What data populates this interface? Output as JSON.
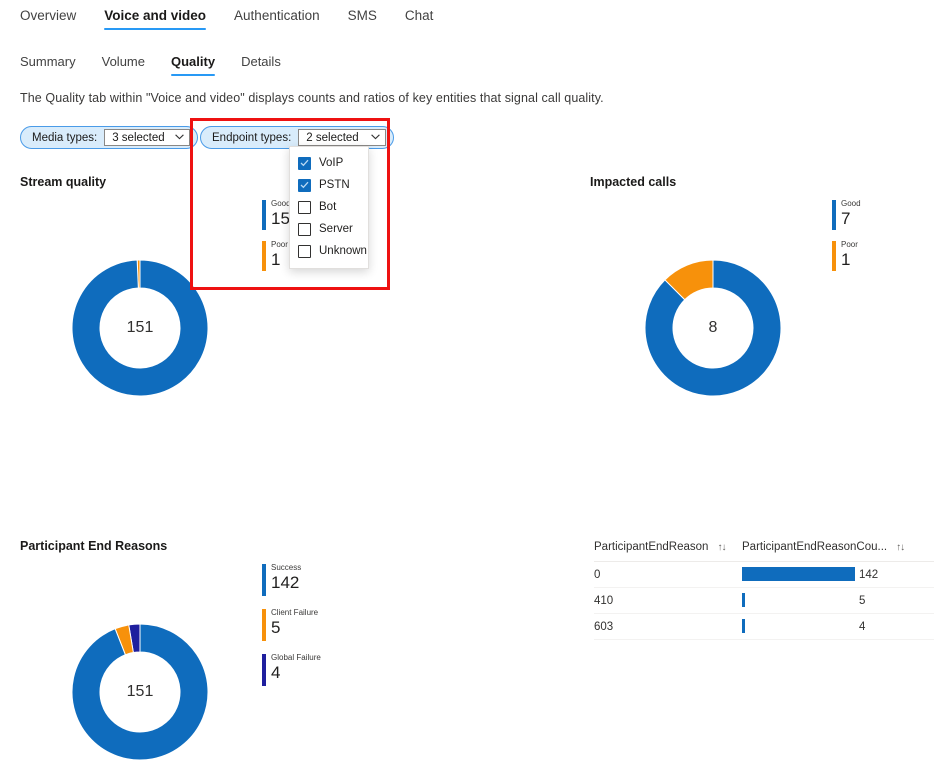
{
  "top_tabs": [
    {
      "label": "Overview",
      "active": false
    },
    {
      "label": "Voice and video",
      "active": true
    },
    {
      "label": "Authentication",
      "active": false
    },
    {
      "label": "SMS",
      "active": false
    },
    {
      "label": "Chat",
      "active": false
    }
  ],
  "sub_tabs": [
    {
      "label": "Summary",
      "active": false
    },
    {
      "label": "Volume",
      "active": false
    },
    {
      "label": "Quality",
      "active": true
    },
    {
      "label": "Details",
      "active": false
    }
  ],
  "description": "The Quality tab within \"Voice and video\" displays counts and ratios of key entities that signal call quality.",
  "filters": [
    {
      "label": "Media types:",
      "value": "3 selected",
      "chevron": "chevron-down-icon"
    },
    {
      "label": "Endpoint types:",
      "value": "2 selected",
      "chevron": "chevron-down-icon"
    }
  ],
  "dropdown": {
    "open_for": "Endpoint types:",
    "options": [
      {
        "label": "VoIP",
        "checked": true
      },
      {
        "label": "PSTN",
        "checked": true
      },
      {
        "label": "Bot",
        "checked": false
      },
      {
        "label": "Server",
        "checked": false
      },
      {
        "label": "Unknown",
        "checked": false
      }
    ]
  },
  "colors": {
    "blue": "#0f6cbd",
    "orange": "#f7910b",
    "navy": "#1f1f9e",
    "lightblue": "#a6c8e8",
    "accent": "#2899f5",
    "highlight_box": "#ee1111"
  },
  "chart_data": [
    {
      "type": "pie",
      "title": "Stream quality",
      "center_total": "151",
      "legend_position": "right",
      "categories": [
        "Good",
        "Poor"
      ],
      "values": [
        150,
        1
      ],
      "labels": [
        "150",
        "1"
      ],
      "colors": [
        "#0f6cbd",
        "#f7910b"
      ]
    },
    {
      "type": "pie",
      "title": "Impacted calls",
      "center_total": "8",
      "legend_position": "right",
      "categories": [
        "Good",
        "Poor"
      ],
      "values": [
        7,
        1
      ],
      "labels": [
        "7",
        "1"
      ],
      "colors": [
        "#0f6cbd",
        "#f7910b"
      ]
    },
    {
      "type": "pie",
      "title": "Participant End Reasons",
      "center_total": "151",
      "legend_position": "right",
      "categories": [
        "Success",
        "Client Failure",
        "Global Failure"
      ],
      "values": [
        142,
        5,
        4
      ],
      "labels": [
        "142",
        "5",
        "4"
      ],
      "colors": [
        "#0f6cbd",
        "#f7910b",
        "#1f1f9e"
      ]
    },
    {
      "type": "table",
      "columns": [
        "ParticipantEndReason",
        "ParticipantEndReasonCou..."
      ],
      "sort_icon": "↑↓",
      "rows": [
        {
          "reason": "0",
          "count": "142",
          "bar_ratio": 1.0
        },
        {
          "reason": "410",
          "count": "5",
          "bar_ratio": 0.02
        },
        {
          "reason": "603",
          "count": "4",
          "bar_ratio": 0.02
        }
      ]
    }
  ]
}
